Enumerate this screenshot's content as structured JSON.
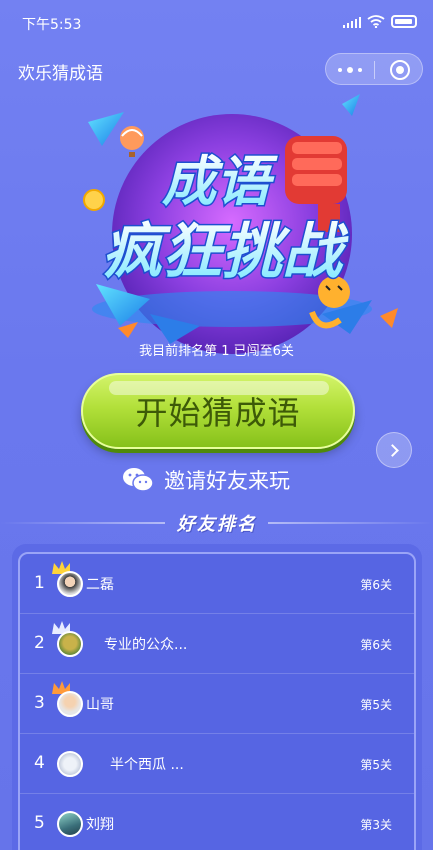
{
  "status_bar": {
    "time": "下午5:53"
  },
  "title_bar": {
    "title": "欢乐猜成语"
  },
  "banner": {
    "logo_line1": "成语",
    "logo_line2": "疯狂挑战",
    "rank_text": "我目前排名第   1   已闯至6关"
  },
  "start_button": {
    "label": "开始猜成语"
  },
  "invite": {
    "label": "邀请好友来玩"
  },
  "ranking": {
    "title": "好友排名",
    "rows": [
      {
        "rank": "1",
        "name": "二磊",
        "level": "第6关"
      },
      {
        "rank": "2",
        "name": "专业的公众...",
        "level": "第6关"
      },
      {
        "rank": "3",
        "name": "山哥",
        "level": "第5关"
      },
      {
        "rank": "4",
        "name": "半个西瓜 ...",
        "level": "第5关"
      },
      {
        "rank": "5",
        "name": "刘翔",
        "level": "第3关"
      }
    ]
  },
  "colors": {
    "background": "#6f7cf0",
    "start_button": "#b2e03a",
    "start_text": "#3d5a08",
    "rank_panel": "#5665e3"
  }
}
